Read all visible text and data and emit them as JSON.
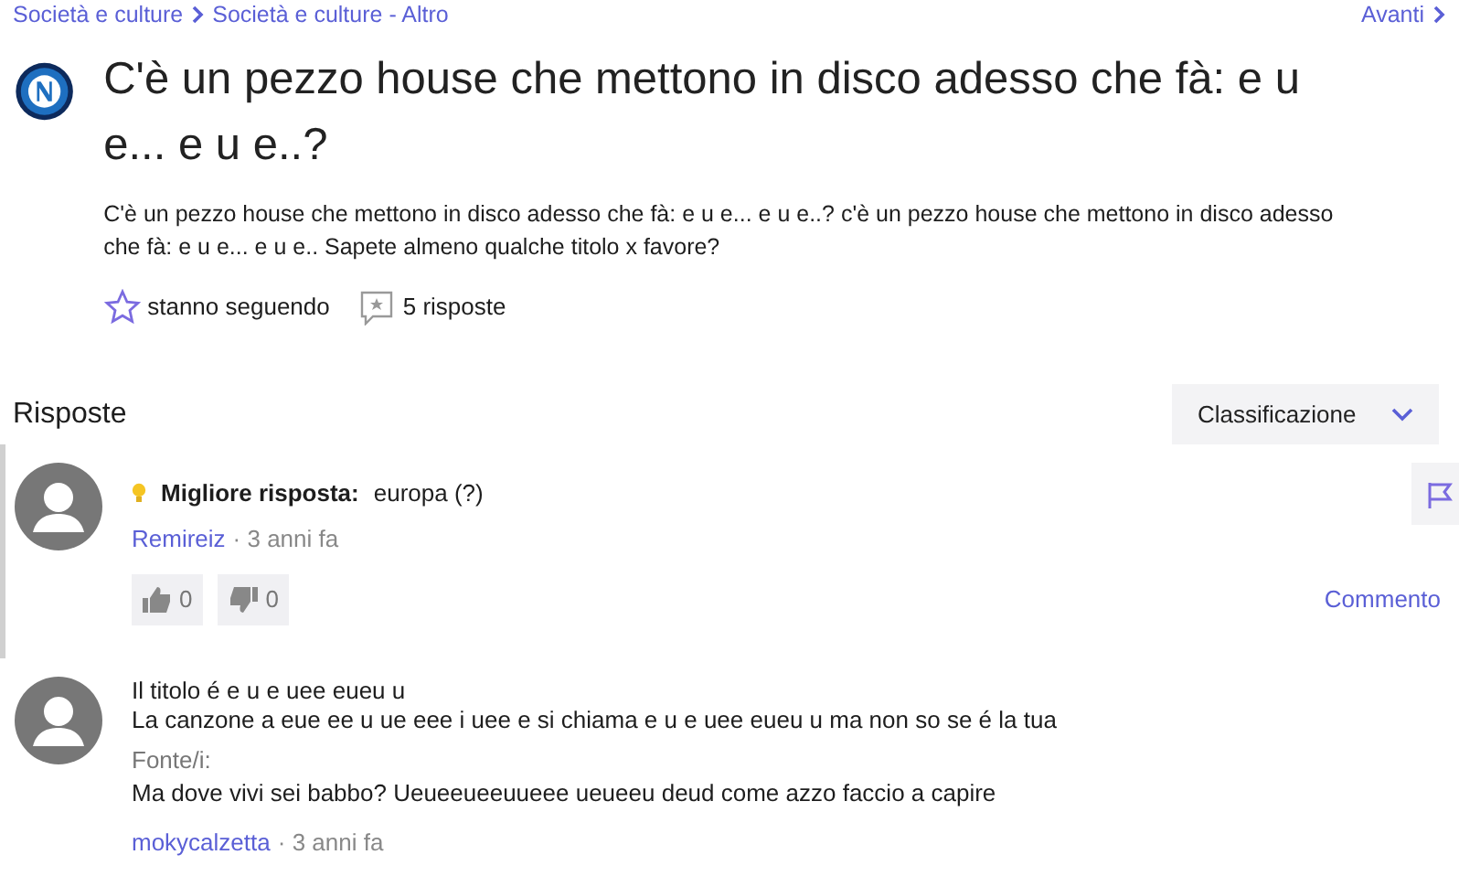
{
  "breadcrumb": [
    {
      "label": "Società e culture"
    },
    {
      "label": "Società e culture - Altro"
    }
  ],
  "next_link": {
    "label": "Avanti"
  },
  "question": {
    "title": "C'è un pezzo house che mettono in disco adesso che fà: e u e... e u e..?",
    "body": "C'è un pezzo house che mettono in disco adesso che fà: e u e... e u e..? c'è un pezzo house che mettono in disco adesso che fà: e u e... e u e.. Sapete almeno qualche titolo x favore?",
    "follow_label": "stanno seguendo",
    "answers_count": "5 risposte"
  },
  "answers_heading": "Risposte",
  "sort_button": {
    "label": "Classificazione"
  },
  "answers": [
    {
      "kind": "best",
      "best_label": "Migliore risposta:",
      "text_lines": [
        "europa (?)"
      ],
      "author": "Remireiz",
      "time": "· 3 anni fa",
      "likes": "0",
      "dislikes": "0",
      "comment_label": "Commento"
    },
    {
      "kind": "regular",
      "text_lines": [
        "Il titolo é e u e uee eueu u",
        "La canzone a eue ee u ue eee i uee e si chiama e u e uee eueu u ma non so se é la tua"
      ],
      "source_label": "Fonte/i:",
      "source": "Ma dove vivi sei babbo? Ueueeueeuueee ueueeu deud come azzo faccio a capire",
      "author": "mokycalzetta",
      "time": "· 3 anni fa"
    }
  ]
}
